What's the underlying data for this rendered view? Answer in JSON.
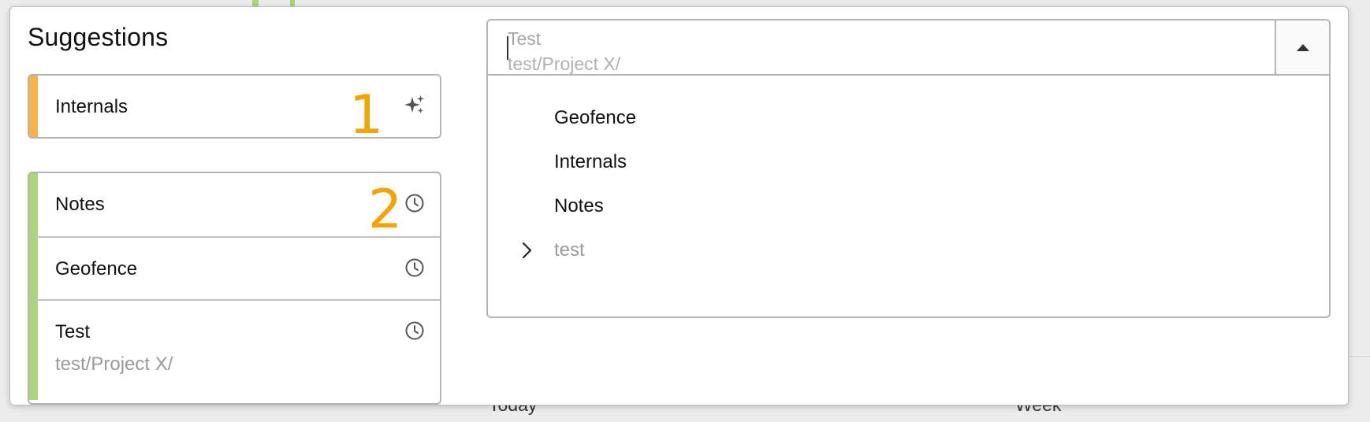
{
  "background": {
    "labels": [
      "Today",
      "Week"
    ]
  },
  "suggestions": {
    "title": "Suggestions",
    "ai_items": [
      {
        "label": "Internals",
        "icon": "sparkles-icon",
        "accent": "#f7b24a"
      }
    ],
    "recent_items": [
      {
        "label": "Notes",
        "icon": "clock-icon",
        "accent": "#a8d47a"
      },
      {
        "label": "Geofence",
        "icon": "clock-icon",
        "accent": "#a8d47a"
      },
      {
        "label": "Test",
        "path": "test/Project X/",
        "icon": "clock-icon",
        "accent": "#a8d47a"
      }
    ]
  },
  "annotations": {
    "marker_1": "1",
    "marker_2": "2",
    "color": "#f5a300"
  },
  "combo": {
    "placeholder_title": "Test",
    "placeholder_path": "test/Project X/",
    "toggle_icon": "caret-up-icon",
    "options": [
      {
        "label": "Geofence"
      },
      {
        "label": "Internals"
      },
      {
        "label": "Notes"
      },
      {
        "label": "test",
        "expandable": true,
        "icon": "chevron-right-icon"
      }
    ]
  }
}
